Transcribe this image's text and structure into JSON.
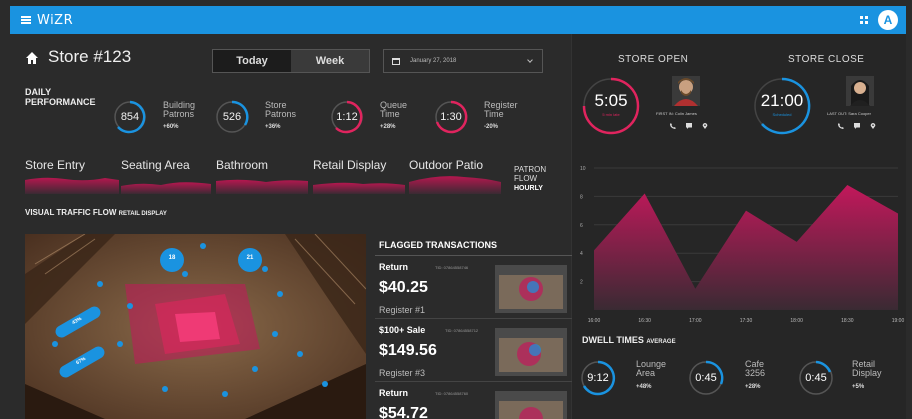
{
  "app": {
    "title": "WiZR",
    "avatar_initial": "A"
  },
  "header": {
    "store_title": "Store #123",
    "tabs": [
      {
        "label": "Today",
        "active": true
      },
      {
        "label": "Week",
        "active": false
      }
    ],
    "date": "January 27, 2018"
  },
  "daily_performance": {
    "label_line1": "DAILY",
    "label_line2": "PERFORMANCE",
    "stats": [
      {
        "value": "854",
        "label1": "Building",
        "label2": "Patrons",
        "delta": "+60%"
      },
      {
        "value": "526",
        "label1": "Store",
        "label2": "Patrons",
        "delta": "+36%"
      },
      {
        "value": "1:12",
        "label1": "Queue",
        "label2": "Time",
        "delta": "+28%"
      },
      {
        "value": "1:30",
        "label1": "Register",
        "label2": "Time",
        "delta": "-20%"
      }
    ]
  },
  "zones": [
    "Store Entry",
    "Seating Area",
    "Bathroom",
    "Retail Display",
    "Outdoor Patio"
  ],
  "patron_flow": {
    "line1": "PATRON",
    "line2": "FLOW",
    "period": "HOURLY"
  },
  "visual_traffic": {
    "title": "VISUAL TRAFFIC FLOW",
    "subtitle": "RETAIL DISPLAY",
    "markers": [
      "18",
      "21",
      "43%",
      "67%"
    ]
  },
  "flagged": {
    "title": "FLAGGED TRANSACTIONS",
    "items": [
      {
        "type": "Return",
        "tid": "TID: 07864558746",
        "amount": "$40.25",
        "register": "Register #1"
      },
      {
        "type": "$100+ Sale",
        "tid": "TID: 07864558712",
        "amount": "$149.56",
        "register": "Register #3"
      },
      {
        "type": "Return",
        "tid": "TID: 07864558760",
        "amount": "$54.72",
        "register": "Register #2"
      }
    ]
  },
  "store_open": {
    "label": "STORE OPEN",
    "time": "5:05",
    "sub": "5 min late",
    "person": "FIRST IN: Colin James"
  },
  "store_close": {
    "label": "STORE CLOSE",
    "time": "21:00",
    "sub": "Scheduled",
    "person": "LAST OUT: Sara Cooper"
  },
  "chart_data": {
    "type": "area",
    "x": [
      "16:00",
      "16:30",
      "17:00",
      "17:30",
      "18:00",
      "18:30",
      "19:00"
    ],
    "y_ticks": [
      2,
      4,
      6,
      8,
      10
    ],
    "ylim": [
      0,
      10
    ],
    "values": [
      4.2,
      8.2,
      1.5,
      7.0,
      4.8,
      8.8,
      6.8
    ],
    "color_top": "#c2185b",
    "color_bottom": "#3a2a33"
  },
  "dwell": {
    "title": "DWELL TIMES",
    "subtitle": "AVERAGE",
    "items": [
      {
        "value": "9:12",
        "label1": "Lounge",
        "label2": "Area",
        "delta": "+48%"
      },
      {
        "value": "0:45",
        "label1": "Cafe",
        "label2": "3256",
        "delta": "+28%"
      },
      {
        "value": "0:45",
        "label1": "Retail",
        "label2": "Display",
        "delta": "+5%"
      }
    ]
  },
  "colors": {
    "accent_blue": "#1a93e0",
    "accent_pink": "#e0245e",
    "background": "#2b2b2b"
  }
}
